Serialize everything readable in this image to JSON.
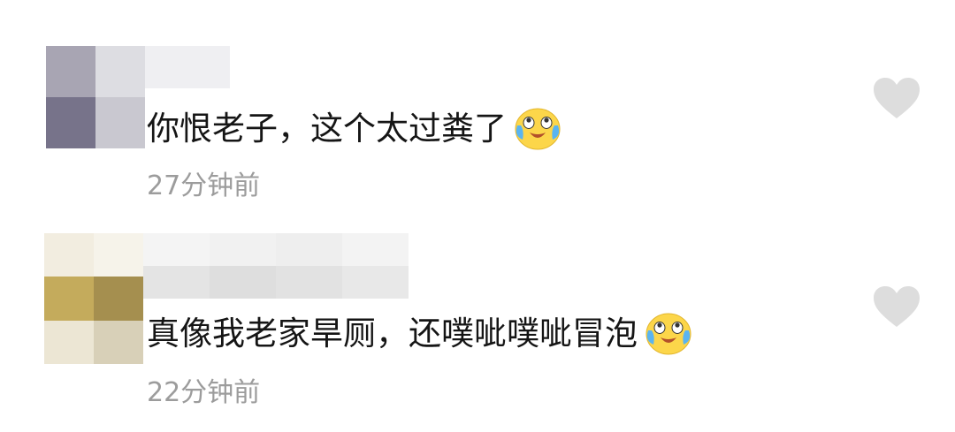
{
  "comments": [
    {
      "text": "你恨老子，这个太过粪了",
      "time": "27分钟前",
      "emoji": "tearful-laugh-emoji",
      "like_icon": "heart-icon"
    },
    {
      "text": "真像我老家旱厕，还噗呲噗呲冒泡",
      "time": "22分钟前",
      "emoji": "tearful-laugh-emoji",
      "like_icon": "heart-icon"
    }
  ],
  "colors": {
    "text": "#151515",
    "time": "#9c9c9c",
    "heart": "#dddddd",
    "emoji_face": "#fcd64a",
    "emoji_tears": "#5ab4f0"
  }
}
